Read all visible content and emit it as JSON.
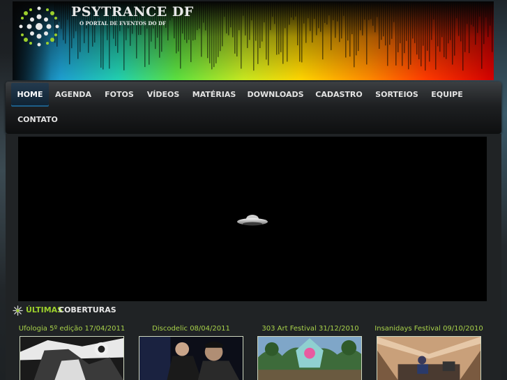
{
  "header": {
    "site_title": "PSYTRANCE DF",
    "site_subtitle": "O PORTAL DE EVENTOS DO DF"
  },
  "nav": {
    "items": [
      {
        "label": "HOME",
        "active": true
      },
      {
        "label": "AGENDA"
      },
      {
        "label": "FOTOS"
      },
      {
        "label": "VÍDEOS"
      },
      {
        "label": "MATÉRIAS"
      },
      {
        "label": "DOWNLOADS"
      },
      {
        "label": "CADASTRO"
      },
      {
        "label": "SORTEIOS"
      },
      {
        "label": "EQUIPE"
      },
      {
        "label": "CONTATO"
      }
    ]
  },
  "section": {
    "title_highlight": "ÚLTIMAS",
    "title_rest": "COBERTURAS"
  },
  "coverages": [
    {
      "title": "Ufologia 5º edição 17/04/2011"
    },
    {
      "title": "Discodelic 08/04/2011"
    },
    {
      "title": "303 Art Festival 31/12/2010"
    },
    {
      "title": "Insanidays Festival 09/10/2010"
    }
  ],
  "colors": {
    "accent_green": "#9ccf2c",
    "nav_active": "#1d5f8a",
    "nav_text": "#e4e4e4"
  }
}
